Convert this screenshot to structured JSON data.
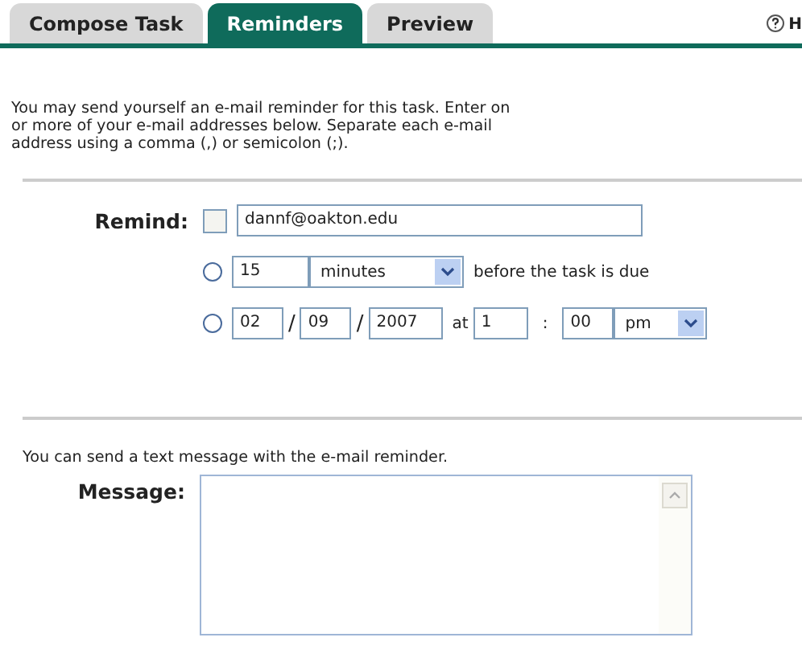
{
  "tabs": [
    {
      "label": "Compose Task",
      "selected": false
    },
    {
      "label": "Reminders",
      "selected": true
    },
    {
      "label": "Preview",
      "selected": false
    }
  ],
  "help": {
    "label": "H"
  },
  "intro_lines": [
    "You may send yourself an e-mail reminder for this task. Enter on",
    "or more of your e-mail addresses below. Separate each e-mail",
    "address using a comma (,) or semicolon (;)."
  ],
  "remind": {
    "label": "Remind:",
    "checked": false,
    "email": "dannf@oakton.edu"
  },
  "relative": {
    "selected": false,
    "amount": "15",
    "unit": "minutes",
    "suffix": "before the task is due"
  },
  "absolute": {
    "selected": false,
    "month": "02",
    "sep1": "/",
    "day": "09",
    "sep2": "/",
    "year": "2007",
    "at": "at",
    "hour": "1",
    "colon": ":",
    "minute": "00",
    "ampm": "pm"
  },
  "message_intro": "You can send a text message with the e-mail reminder.",
  "message": {
    "label": "Message:"
  }
}
